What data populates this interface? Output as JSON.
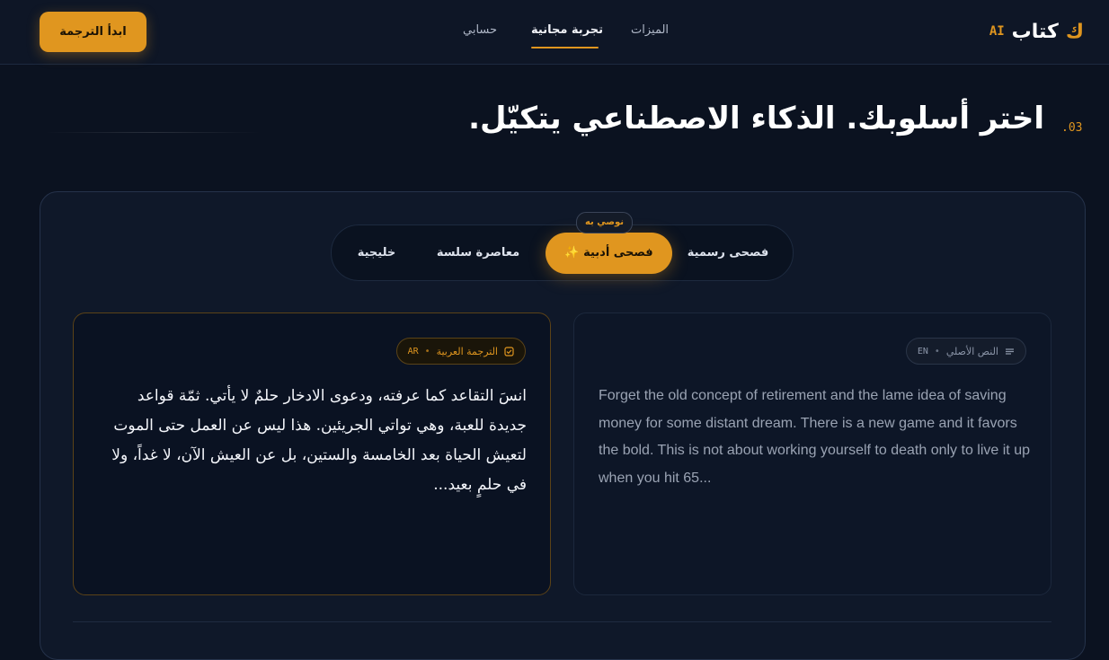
{
  "nav": {
    "logo_mark": "ك",
    "logo_text": "كتاب",
    "logo_ai": "AI",
    "links": [
      {
        "label": "الميزات"
      },
      {
        "label": "تجربة مجانية",
        "active": true
      },
      {
        "label": "حسابي"
      }
    ],
    "cta_label": "ابدأ الترجمة"
  },
  "section": {
    "number": ".03",
    "heading": "اختر أسلوبك. الذكاء الاصطناعي يتكيّل."
  },
  "styles": {
    "tabs": [
      {
        "label": "فصحى رسمية"
      },
      {
        "label": "فصحى أدبية ✨",
        "active": true
      },
      {
        "label": "معاصرة سلسة"
      },
      {
        "label": "خليجية"
      }
    ],
    "recommended_badge": "نوصي به"
  },
  "translation": {
    "label": "الترجمة العربية",
    "code": "AR",
    "icon": "edit-check-icon",
    "text": "انسَ التقاعد كما عرفته، ودعوى الادخار حلمٌ لا يأتي. ثمّة قواعد جديدة للعبة، وهي تواتي الجريئين. هذا ليس عن العمل حتى الموت لتعيش الحياة بعد الخامسة والستين، بل عن العيش الآن، لا غداً، ولا في حلمٍ بعيد..."
  },
  "original": {
    "label": "النص الأصلي",
    "code": "EN",
    "icon": "lines-icon",
    "text": "Forget the old concept of retirement and the lame idea of saving money for some distant dream. There is a new game and it favors the bold. This is not about working yourself to death only to live it up when you hit 65..."
  },
  "colors": {
    "accent": "#e0961f",
    "background": "#0b1220",
    "panel": "#0f1829"
  }
}
